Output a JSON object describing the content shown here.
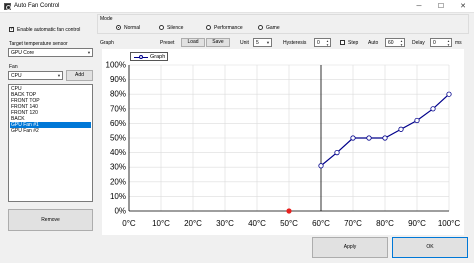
{
  "window": {
    "title": "Auto Fan Control",
    "min_icon": "─",
    "max_icon": "☐",
    "close_icon": "✕"
  },
  "left": {
    "enable_label": "Enable automatic fan control",
    "enable_checked": true,
    "target_sensor_label": "Target temperature sensor",
    "target_sensor_value": "GPU Core",
    "fan_label": "Fan",
    "fan_select_value": "CPU",
    "add_label": "Add",
    "fans": [
      "CPU",
      "BACK TOP",
      "FRONT TOP",
      "FRONT 140",
      "FRONT 120",
      "BACK",
      "GPU Fan #1",
      "GPU Fan #2"
    ],
    "selected_fan_index": 6,
    "remove_label": "Remove"
  },
  "mode": {
    "label": "Mode",
    "options": [
      "Normal",
      "Silence",
      "Performance",
      "Game"
    ],
    "selected_index": 0
  },
  "graph_controls": {
    "graph_label": "Graph",
    "preset_label": "Preset",
    "load_label": "Load",
    "save_label": "Save",
    "unit_label": "Unit",
    "unit_value": "5",
    "hysteresis_label": "Hysteresis",
    "hysteresis_value": "0",
    "step_label": "Step",
    "step_checked": false,
    "auto_label": "Auto",
    "auto_value": "60",
    "delay_label": "Delay",
    "delay_value": "0",
    "delay_unit": "ms"
  },
  "chart_data": {
    "type": "line",
    "legend": "Graph",
    "x_ticks": [
      "0°C",
      "10°C",
      "20°C",
      "30°C",
      "40°C",
      "50°C",
      "60°C",
      "70°C",
      "80°C",
      "90°C",
      "100°C"
    ],
    "y_ticks": [
      "0%",
      "10%",
      "20%",
      "30%",
      "40%",
      "50%",
      "60%",
      "70%",
      "80%",
      "90%",
      "100%"
    ],
    "xlim": [
      0,
      100
    ],
    "ylim": [
      0,
      100
    ],
    "series": [
      {
        "x": [
          60,
          65,
          70,
          75,
          80,
          85,
          90,
          95,
          100
        ],
        "y": [
          31,
          40,
          50,
          50,
          50,
          56,
          62,
          70,
          80
        ],
        "color": "#00008b"
      }
    ],
    "current_temperature": 50,
    "current_marker_color": "#e8201e",
    "grid": true
  },
  "footer": {
    "apply_label": "Apply",
    "ok_label": "OK"
  }
}
